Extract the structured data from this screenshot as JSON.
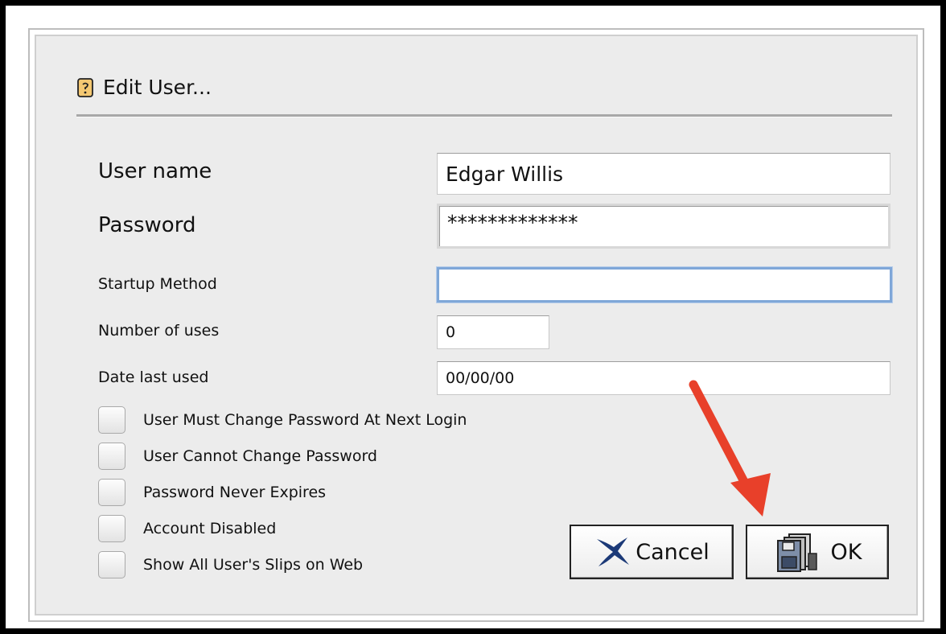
{
  "dialog": {
    "title": "Edit User...",
    "icon": "user-card-icon"
  },
  "fields": {
    "user_name": {
      "label": "User name",
      "value": "Edgar Willis"
    },
    "password": {
      "label": "Password",
      "value": "*************"
    },
    "startup_method": {
      "label": "Startup Method",
      "value": ""
    },
    "number_of_uses": {
      "label": "Number of uses",
      "value": "0"
    },
    "date_last_used": {
      "label": "Date last used",
      "value": "00/00/00"
    }
  },
  "checkboxes": [
    {
      "label": "User Must Change Password At Next Login",
      "checked": false
    },
    {
      "label": "User Cannot Change Password",
      "checked": false
    },
    {
      "label": "Password Never Expires",
      "checked": false
    },
    {
      "label": "Account Disabled",
      "checked": false
    },
    {
      "label": "Show All User's Slips on Web",
      "checked": false
    }
  ],
  "buttons": {
    "cancel": {
      "label": "Cancel",
      "icon": "x-icon"
    },
    "ok": {
      "label": "OK",
      "icon": "save-disk-icon"
    }
  },
  "annotation": {
    "arrow_color": "#e8402a"
  },
  "colors": {
    "focus_ring": "#7fa7d8",
    "dialog_bg": "#ececec"
  }
}
